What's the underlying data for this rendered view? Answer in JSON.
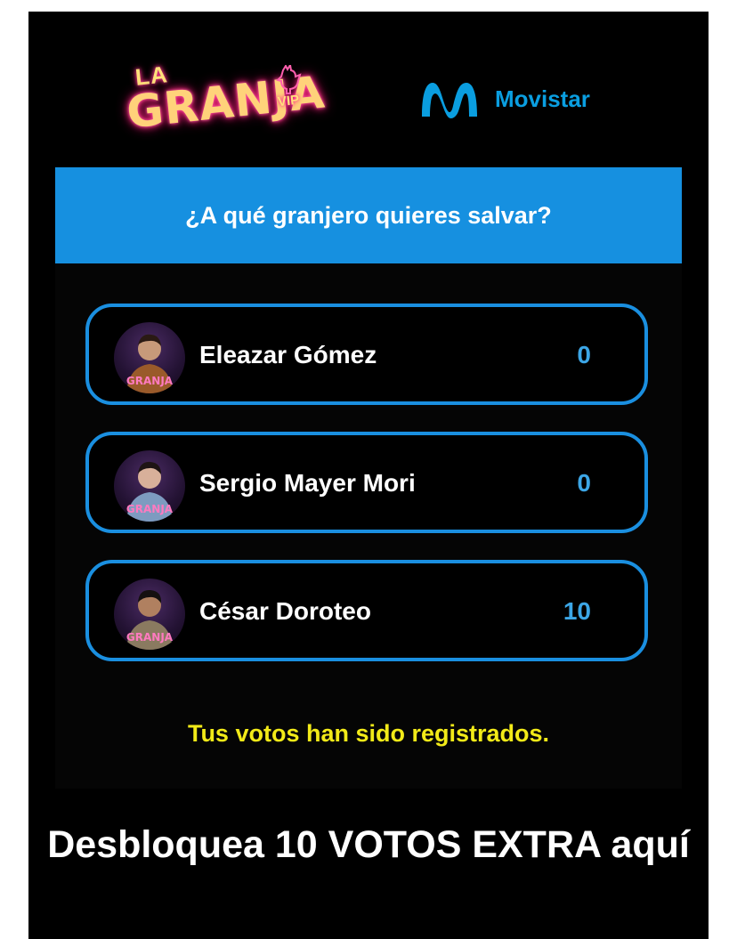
{
  "logos": {
    "granja": {
      "la": "LA",
      "main": "GRANJA",
      "vip": "VIP",
      "icon": "rooster-icon"
    },
    "movistar": {
      "text": "Movistar",
      "icon": "movistar-m-icon",
      "color": "#0a9ee0"
    }
  },
  "question": "¿A qué granjero quieres salvar?",
  "options": [
    {
      "name": "Eleazar Gómez",
      "votes": "0",
      "avatar": "avatar-eleazar"
    },
    {
      "name": "Sergio Mayer Mori",
      "votes": "0",
      "avatar": "avatar-sergio"
    },
    {
      "name": "César Doroteo",
      "votes": "10",
      "avatar": "avatar-cesar"
    }
  ],
  "confirmation": "Tus votos han sido registrados.",
  "extra_votes": "Desbloquea 10 VOTOS EXTRA aquí",
  "colors": {
    "accent_blue": "#1690e0",
    "option_border": "#1a8fe0",
    "count": "#3ca6e6",
    "confirmation": "#f2ea18",
    "background": "#000000"
  }
}
